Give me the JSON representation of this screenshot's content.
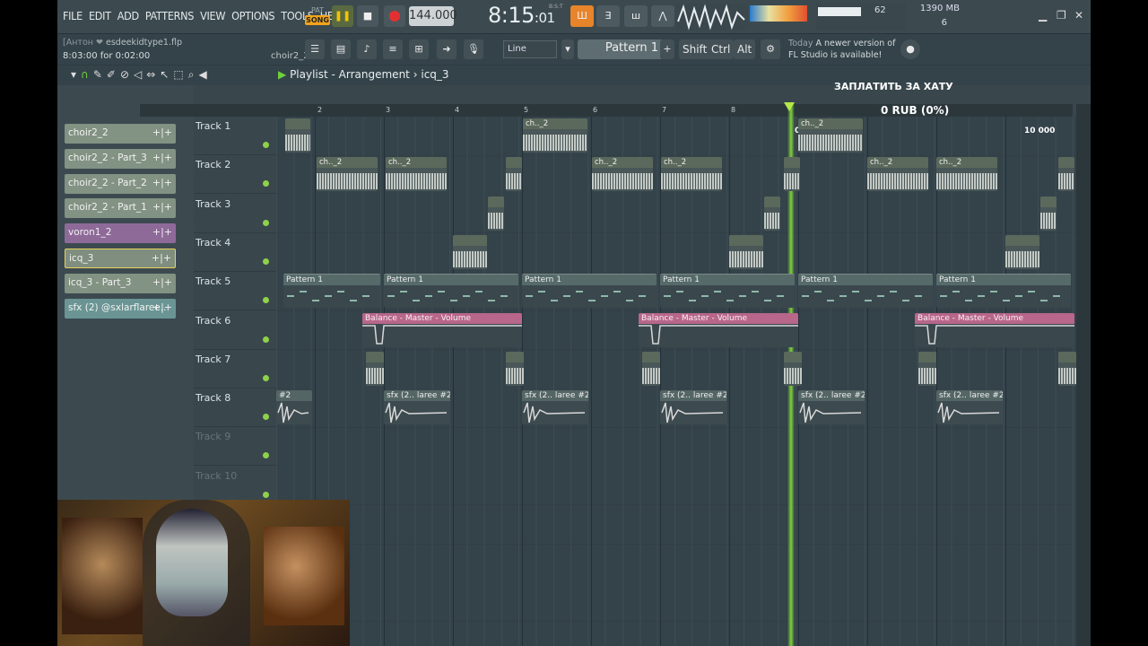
{
  "menu": [
    "FILE",
    "EDIT",
    "ADD",
    "PATTERNS",
    "VIEW",
    "OPTIONS",
    "TOOLS",
    "HELP"
  ],
  "transport": {
    "pat_label": "PAT",
    "song_label": "SONG",
    "tempo": "144.000",
    "time_main": "8:15",
    "time_sub": ":01",
    "time_tag": "B:S:T"
  },
  "cpu": {
    "value": "62",
    "memory": "1390 MB",
    "polyphony": "6"
  },
  "hint": {
    "user": "[Антон ❤",
    "file": "esdeekidtype1.flp",
    "line2": "8:03:00 for 0:02:00",
    "channel": "choir2_2"
  },
  "snap": "Line",
  "pattern_selector": "Pattern 1",
  "keys": [
    "Shift",
    "Ctrl",
    "Alt"
  ],
  "news": {
    "today": "Today",
    "text1": "A newer version of",
    "text2": "FL Studio is available!"
  },
  "playlist": {
    "title": "Playlist - Arrangement",
    "sep": "›",
    "current": "icq_3"
  },
  "panel_items": [
    {
      "label": "choir2_2",
      "style": "green"
    },
    {
      "label": "choir2_2 - Part_3",
      "style": "green"
    },
    {
      "label": "choir2_2 - Part_2",
      "style": "green"
    },
    {
      "label": "choir2_2 - Part_1",
      "style": "green"
    },
    {
      "label": "voron1_2",
      "style": "purple"
    },
    {
      "label": "icq_3",
      "style": "sel"
    },
    {
      "label": "icq_3 - Part_3",
      "style": "green"
    },
    {
      "label": "sfx (2) @sxlarflaree..",
      "style": "teal"
    }
  ],
  "timeline_numbers": [
    "2",
    "3",
    "4",
    "5",
    "6",
    "7",
    "8"
  ],
  "tracks": [
    "Track 1",
    "Track 2",
    "Track 3",
    "Track 4",
    "Track 5",
    "Track 6",
    "Track 7",
    "Track 8",
    "Track 9",
    "Track 10"
  ],
  "clips": {
    "ch": "ch.._2",
    "pattern": "Pattern 1",
    "auto": "Balance - Master - Volume",
    "sfx": "sfx (2.. laree #2",
    "sfx_short": "#2"
  },
  "donation": {
    "title": "ЗАПЛАТИТЬ ЗА ХАТУ",
    "amount": "0 RUB (0%)",
    "goal_start": "0",
    "goal_end": "10 000"
  },
  "colors": {
    "accent": "#f2a41a",
    "play_green": "#7fd23a",
    "automation": "#b8668a",
    "record": "#e23030"
  }
}
